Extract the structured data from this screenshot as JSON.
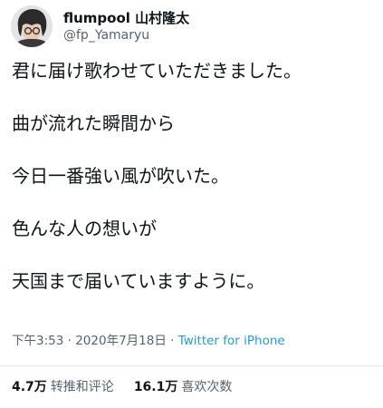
{
  "author": {
    "display_name": "flumpool 山村隆太",
    "handle": "@fp_Yamaryu",
    "avatar_icon": "profile-photo"
  },
  "tweet": {
    "lines": [
      "君に届け歌わせていただきました。",
      "曲が流れた瞬間から",
      "今日一番強い風が吹いた。",
      "色んな人の想いが",
      "天国まで届いていますように。"
    ]
  },
  "meta": {
    "time": "下午3:53",
    "separator1": "·",
    "date": "2020年7月18日",
    "separator2": "·",
    "source": "Twitter for iPhone"
  },
  "stats": {
    "retweets_count": "4.7万",
    "retweets_label": "转推和评论",
    "likes_count": "16.1万",
    "likes_label": "喜欢次数"
  },
  "colors": {
    "text": "#0f1419",
    "secondary": "#536471",
    "link": "#1d9bf0",
    "divider": "#e6e9eb"
  }
}
